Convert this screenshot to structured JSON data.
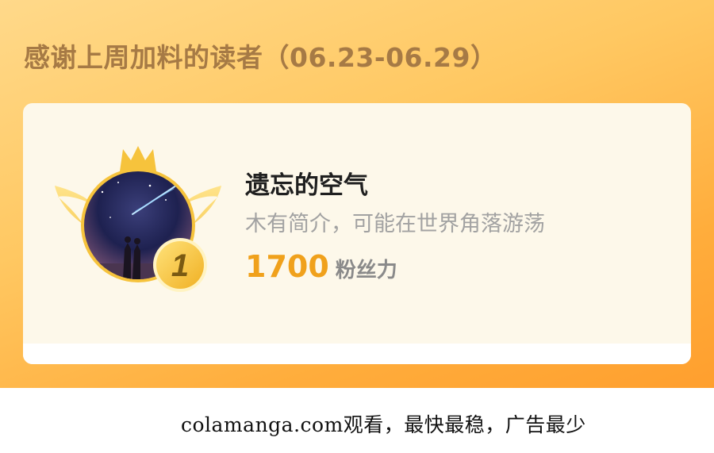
{
  "banner": {
    "title": "感谢上周加料的读者（06.23-06.29）"
  },
  "top_reader": {
    "rank": "1",
    "name": "遗忘的空气",
    "bio": "木有简介，可能在世界角落游荡",
    "fan_power_value": "1700",
    "fan_power_unit": "粉丝力"
  },
  "footer": {
    "text": "colamanga.com观看，最快最稳，广告最少"
  },
  "colors": {
    "banner_gradient_start": "#ffd98a",
    "banner_gradient_end": "#ff9f2e",
    "title_brown": "#a67a45",
    "card_bg": "#fdf8ea",
    "fan_value_orange": "#f0a11c",
    "badge_gold": "#f6c33c"
  }
}
